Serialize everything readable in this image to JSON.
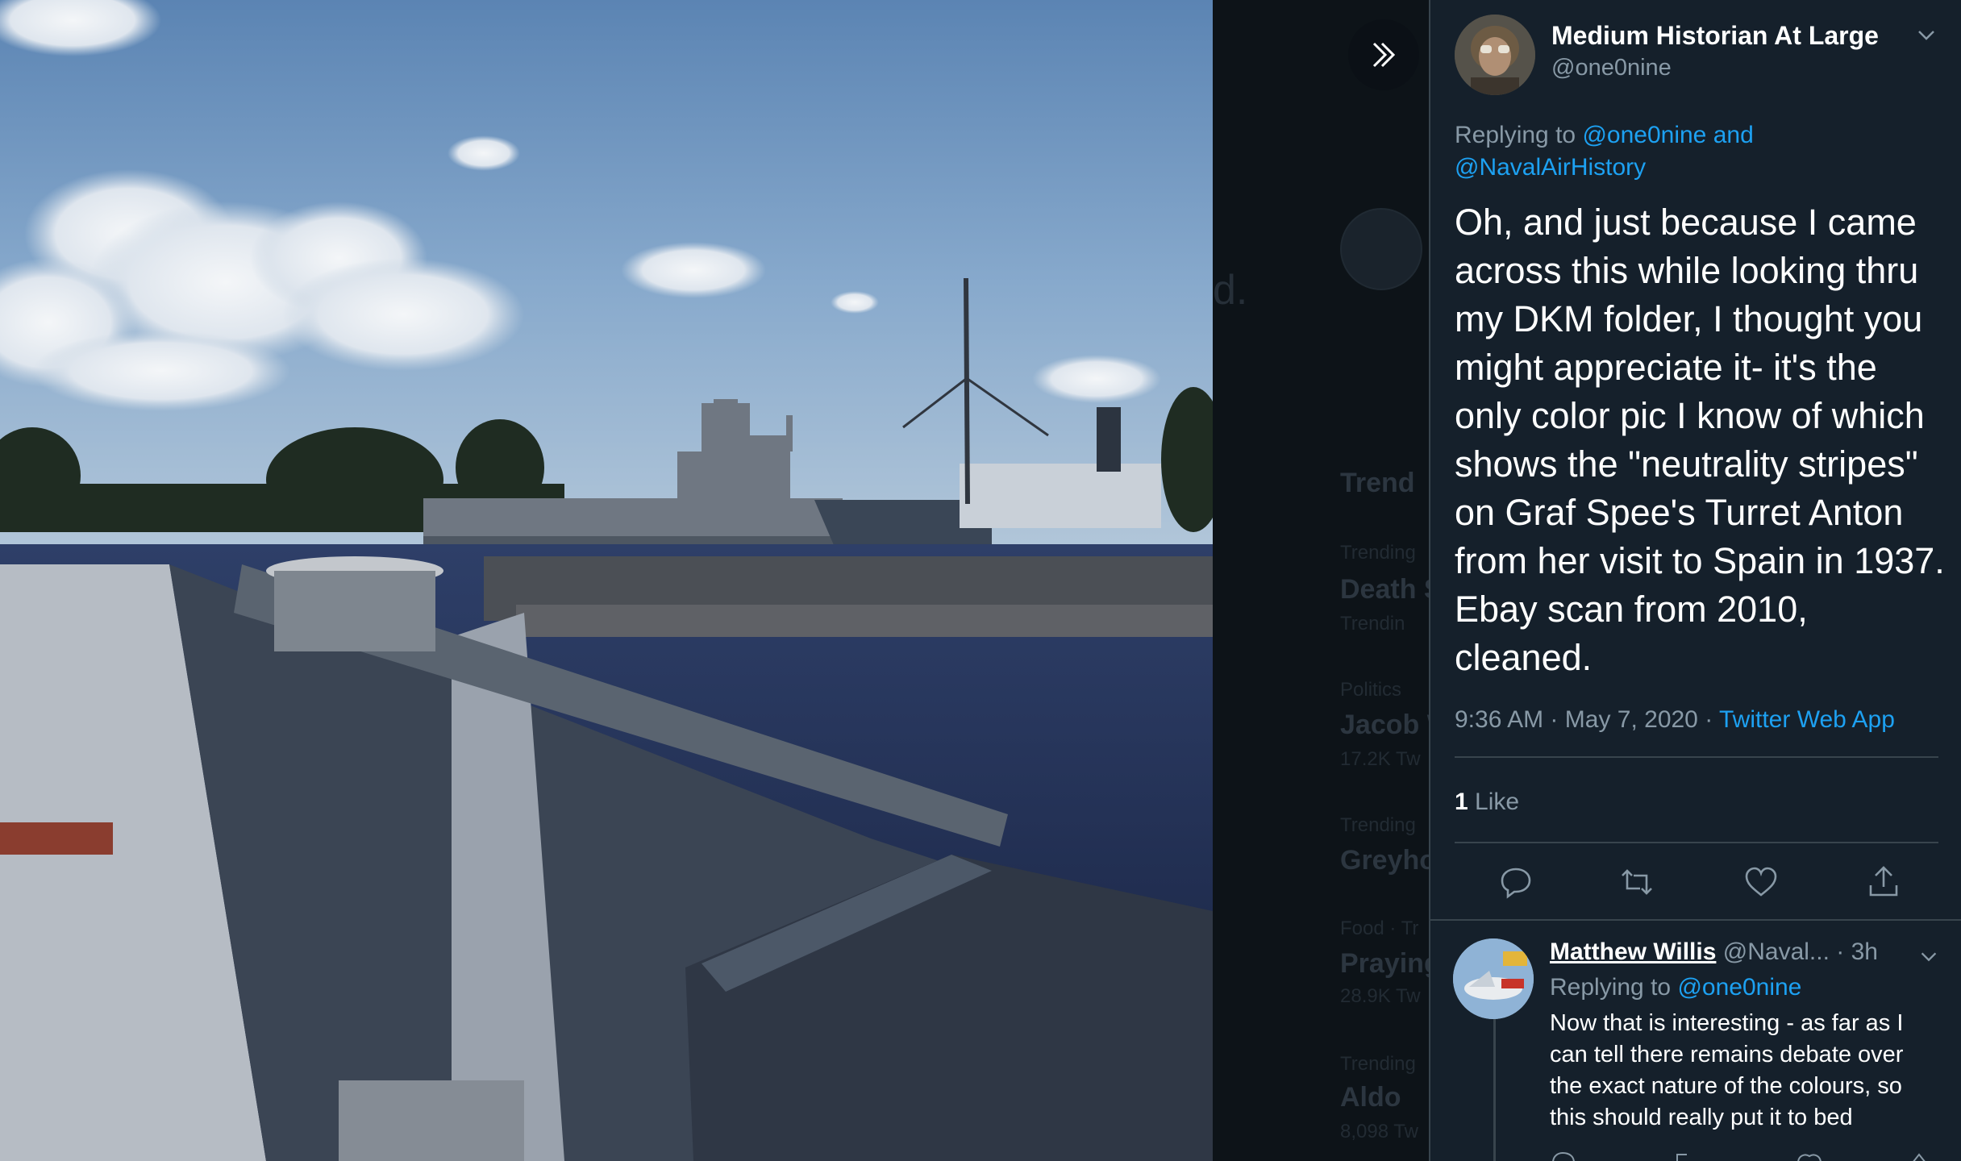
{
  "author": {
    "name": "Medium Historian At Large",
    "handle": "@one0nine"
  },
  "tweet": {
    "replying_prefix": "Replying to",
    "replying_to_1": "@one0nine",
    "replying_and": "and",
    "replying_to_2": "@NavalAirHistory",
    "text": "Oh, and just because I came across this while looking thru my DKM folder, I thought you might appreciate it- it's the only color pic I know of which shows the \"neutrality stripes\" on Graf Spee's Turret Anton from her visit to Spain in 1937. Ebay scan from 2010, cleaned.",
    "time": "9:36 AM",
    "date": "May 7, 2020",
    "separator": "·",
    "source": "Twitter Web App",
    "like_count": "1",
    "like_label": "Like"
  },
  "reply": {
    "name": "Matthew Willis",
    "handle": "@Naval...",
    "age": "· 3h",
    "replying_prefix": "Replying to",
    "replying_to": "@one0nine",
    "text": "Now that is interesting - as far as I can tell there remains debate over the exact nature of the colours, so this should really put it to bed"
  },
  "backdrop": {
    "heading": "Trend",
    "items": [
      {
        "cat": "Trending",
        "title": "Death S",
        "sub": "Trendin"
      },
      {
        "cat": "Politics",
        "title": "Jacob W",
        "sub": "17.2K Tw"
      },
      {
        "cat": "Trending",
        "title": "Greyhou",
        "sub": ""
      },
      {
        "cat": "Food · Tr",
        "title": "Praying",
        "sub": "28.9K Tw"
      },
      {
        "cat": "Trending",
        "title": "Aldo",
        "sub": "8,098 Tw"
      }
    ]
  },
  "icons": {
    "expand": "double-chevron-right-icon",
    "reply": "reply-bubble-icon",
    "retweet": "retweet-icon",
    "like": "heart-icon",
    "share": "share-upload-icon",
    "menu": "chevron-down-icon"
  },
  "colors": {
    "panel_bg": "#15202b",
    "link": "#1da1f2",
    "muted": "#8899a6",
    "divider": "#38444d"
  }
}
